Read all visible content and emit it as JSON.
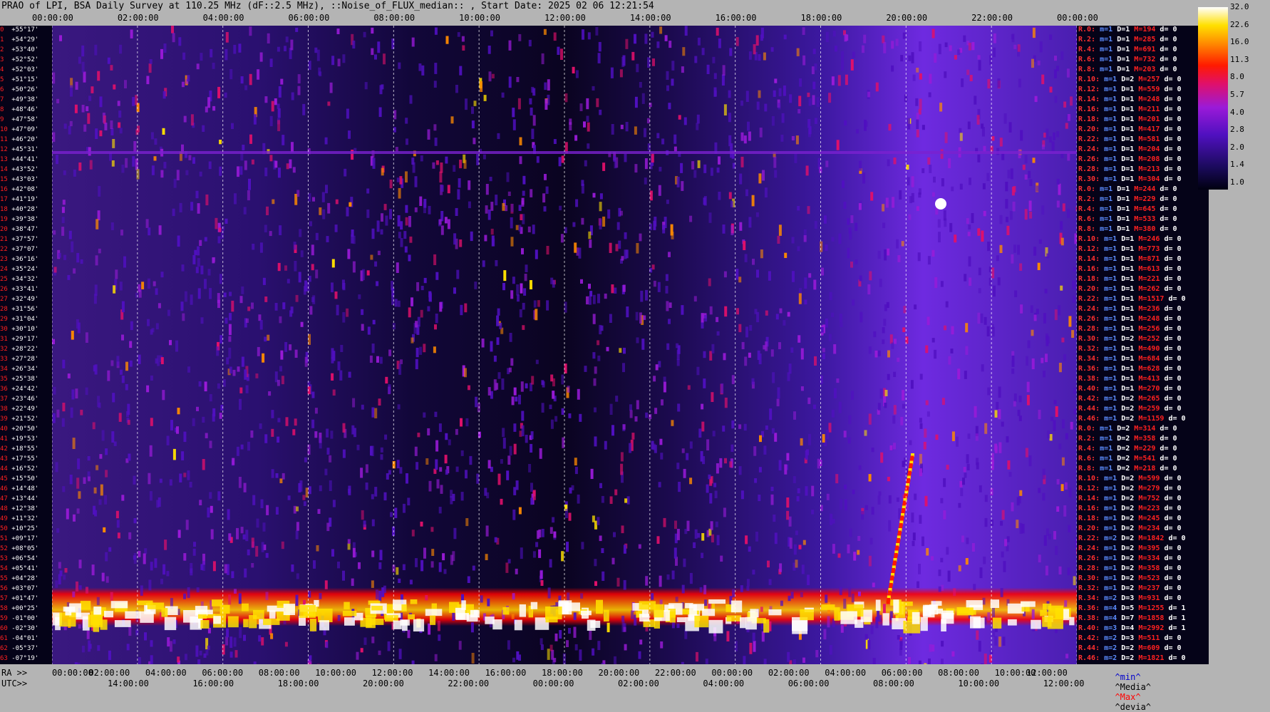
{
  "title": "PRAO of LPI, BSA Daily Survey at 110.25 MHz (dF::2.5 MHz), ::Noise_of_FLUX_median:: , Start Date: 2025 02 06 12:21:54",
  "chart_data": {
    "type": "heatmap",
    "title": "PRAO of LPI, BSA Daily Survey at 110.25 MHz (dF::2.5 MHz), ::Noise_of_FLUX_median:: , Start Date: 2025 02 06 12:21:54",
    "top_axis_ticks": [
      "00:00:00",
      "02:00:00",
      "04:00:00",
      "06:00:00",
      "08:00:00",
      "10:00:00",
      "12:00:00",
      "14:00:00",
      "16:00:00",
      "18:00:00",
      "20:00:00",
      "22:00:00",
      "00:00:00"
    ],
    "ra_axis_label": "RA >>",
    "ra_axis_ticks": [
      "00:00:00",
      "02:00:00",
      "04:00:00",
      "06:00:00",
      "08:00:00",
      "10:00:00",
      "12:00:00",
      "14:00:00",
      "16:00:00",
      "18:00:00",
      "20:00:00",
      "22:00:00",
      "00:00:00",
      "02:00:00",
      "04:00:00",
      "06:00:00",
      "08:00:00",
      "10:00:00",
      "12:00:00"
    ],
    "utc_axis_label": "UTC>>",
    "utc_axis_ticks": [
      "14:00:00",
      "16:00:00",
      "18:00:00",
      "20:00:00",
      "22:00:00",
      "00:00:00",
      "02:00:00",
      "04:00:00",
      "06:00:00",
      "08:00:00",
      "10:00:00",
      "12:00:00"
    ],
    "colorbar_ticks": [
      "32.0",
      "22.6",
      "16.0",
      "11.3",
      "8.0",
      "5.7",
      "4.0",
      "2.8",
      "2.0",
      "1.4",
      "1.0"
    ],
    "colorbar_range": [
      1.0,
      32.0
    ],
    "colorbar_colors": [
      "#000010",
      "#1a0a5a",
      "#5010c0",
      "#9a1ad8",
      "#e0106a",
      "#ff1a00",
      "#ff8a00",
      "#ffe000",
      "#ffffff"
    ],
    "declinations": [
      "+55°17'",
      "+54°29'",
      "+53°40'",
      "+52°52'",
      "+52°03'",
      "+51°15'",
      "+50°26'",
      "+49°38'",
      "+48°46'",
      "+47°58'",
      "+47°09'",
      "+46°20'",
      "+45°31'",
      "+44°41'",
      "+43°52'",
      "+43°03'",
      "+42°08'",
      "+41°19'",
      "+40°28'",
      "+39°38'",
      "+38°47'",
      "+37°57'",
      "+37°07'",
      "+36°16'",
      "+35°24'",
      "+34°32'",
      "+33°41'",
      "+32°49'",
      "+31°56'",
      "+31°04'",
      "+30°10'",
      "+29°17'",
      "+28°22'",
      "+27°28'",
      "+26°34'",
      "+25°38'",
      "+24°42'",
      "+23°46'",
      "+22°49'",
      "+21°52'",
      "+20°50'",
      "+19°53'",
      "+18°55'",
      "+17°55'",
      "+16°52'",
      "+15°50'",
      "+14°48'",
      "+13°44'",
      "+12°38'",
      "+11°32'",
      "+10°25'",
      "+09°17'",
      "+08°05'",
      "+06°54'",
      "+05°41'",
      "+04°28'",
      "+03°07'",
      "+01°47'",
      "+00°25'",
      "-01°00'",
      "-02°30'",
      "-04°01'",
      "-05°37'",
      "-07°19'"
    ],
    "beam_stats": [
      {
        "r": "R.0:",
        "m": "1",
        "D": "1",
        "M": "194",
        "d": "0"
      },
      {
        "r": "R.2:",
        "m": "1",
        "D": "1",
        "M": "285",
        "d": "0"
      },
      {
        "r": "R.4:",
        "m": "1",
        "D": "1",
        "M": "691",
        "d": "0"
      },
      {
        "r": "R.6:",
        "m": "1",
        "D": "1",
        "M": "732",
        "d": "0"
      },
      {
        "r": "R.8:",
        "m": "1",
        "D": "1",
        "M": "203",
        "d": "0"
      },
      {
        "r": "R.10:",
        "m": "1",
        "D": "2",
        "M": "257",
        "d": "0"
      },
      {
        "r": "R.12:",
        "m": "1",
        "D": "1",
        "M": "559",
        "d": "0"
      },
      {
        "r": "R.14:",
        "m": "1",
        "D": "1",
        "M": "248",
        "d": "0"
      },
      {
        "r": "R.16:",
        "m": "1",
        "D": "1",
        "M": "211",
        "d": "0"
      },
      {
        "r": "R.18:",
        "m": "1",
        "D": "1",
        "M": "201",
        "d": "0"
      },
      {
        "r": "R.20:",
        "m": "1",
        "D": "1",
        "M": "417",
        "d": "0"
      },
      {
        "r": "R.22:",
        "m": "1",
        "D": "1",
        "M": "581",
        "d": "0"
      },
      {
        "r": "R.24:",
        "m": "1",
        "D": "1",
        "M": "204",
        "d": "0"
      },
      {
        "r": "R.26:",
        "m": "1",
        "D": "1",
        "M": "208",
        "d": "0"
      },
      {
        "r": "R.28:",
        "m": "1",
        "D": "1",
        "M": "213",
        "d": "0"
      },
      {
        "r": "R.30:",
        "m": "1",
        "D": "1",
        "M": "304",
        "d": "0"
      },
      {
        "r": "R.0:",
        "m": "1",
        "D": "1",
        "M": "244",
        "d": "0"
      },
      {
        "r": "R.2:",
        "m": "1",
        "D": "1",
        "M": "229",
        "d": "0"
      },
      {
        "r": "R.4:",
        "m": "1",
        "D": "1",
        "M": "645",
        "d": "0"
      },
      {
        "r": "R.6:",
        "m": "1",
        "D": "1",
        "M": "533",
        "d": "0"
      },
      {
        "r": "R.8:",
        "m": "1",
        "D": "1",
        "M": "380",
        "d": "0"
      },
      {
        "r": "R.10:",
        "m": "1",
        "D": "1",
        "M": "246",
        "d": "0"
      },
      {
        "r": "R.12:",
        "m": "1",
        "D": "1",
        "M": "773",
        "d": "0"
      },
      {
        "r": "R.14:",
        "m": "1",
        "D": "1",
        "M": "871",
        "d": "0"
      },
      {
        "r": "R.16:",
        "m": "1",
        "D": "1",
        "M": "613",
        "d": "0"
      },
      {
        "r": "R.18:",
        "m": "1",
        "D": "1",
        "M": "221",
        "d": "0"
      },
      {
        "r": "R.20:",
        "m": "1",
        "D": "1",
        "M": "262",
        "d": "0"
      },
      {
        "r": "R.22:",
        "m": "1",
        "D": "1",
        "M": "1517",
        "d": "0"
      },
      {
        "r": "R.24:",
        "m": "1",
        "D": "1",
        "M": "236",
        "d": "0"
      },
      {
        "r": "R.26:",
        "m": "1",
        "D": "1",
        "M": "248",
        "d": "0"
      },
      {
        "r": "R.28:",
        "m": "1",
        "D": "1",
        "M": "256",
        "d": "0"
      },
      {
        "r": "R.30:",
        "m": "1",
        "D": "2",
        "M": "252",
        "d": "0"
      },
      {
        "r": "R.32:",
        "m": "1",
        "D": "1",
        "M": "490",
        "d": "0"
      },
      {
        "r": "R.34:",
        "m": "1",
        "D": "1",
        "M": "684",
        "d": "0"
      },
      {
        "r": "R.36:",
        "m": "1",
        "D": "1",
        "M": "628",
        "d": "0"
      },
      {
        "r": "R.38:",
        "m": "1",
        "D": "1",
        "M": "413",
        "d": "0"
      },
      {
        "r": "R.40:",
        "m": "1",
        "D": "1",
        "M": "270",
        "d": "0"
      },
      {
        "r": "R.42:",
        "m": "1",
        "D": "2",
        "M": "265",
        "d": "0"
      },
      {
        "r": "R.44:",
        "m": "1",
        "D": "2",
        "M": "259",
        "d": "0"
      },
      {
        "r": "R.46:",
        "m": "1",
        "D": "2",
        "M": "1159",
        "d": "0"
      },
      {
        "r": "R.0:",
        "m": "1",
        "D": "2",
        "M": "314",
        "d": "0"
      },
      {
        "r": "R.2:",
        "m": "1",
        "D": "2",
        "M": "358",
        "d": "0"
      },
      {
        "r": "R.4:",
        "m": "1",
        "D": "2",
        "M": "229",
        "d": "0"
      },
      {
        "r": "R.6:",
        "m": "1",
        "D": "2",
        "M": "541",
        "d": "0"
      },
      {
        "r": "R.8:",
        "m": "1",
        "D": "2",
        "M": "218",
        "d": "0"
      },
      {
        "r": "R.10:",
        "m": "1",
        "D": "2",
        "M": "599",
        "d": "0"
      },
      {
        "r": "R.12:",
        "m": "1",
        "D": "2",
        "M": "279",
        "d": "0"
      },
      {
        "r": "R.14:",
        "m": "1",
        "D": "2",
        "M": "752",
        "d": "0"
      },
      {
        "r": "R.16:",
        "m": "1",
        "D": "2",
        "M": "223",
        "d": "0"
      },
      {
        "r": "R.18:",
        "m": "1",
        "D": "2",
        "M": "245",
        "d": "0"
      },
      {
        "r": "R.20:",
        "m": "1",
        "D": "2",
        "M": "234",
        "d": "0"
      },
      {
        "r": "R.22:",
        "m": "2",
        "D": "2",
        "M": "1842",
        "d": "0"
      },
      {
        "r": "R.24:",
        "m": "1",
        "D": "2",
        "M": "395",
        "d": "0"
      },
      {
        "r": "R.26:",
        "m": "1",
        "D": "2",
        "M": "334",
        "d": "0"
      },
      {
        "r": "R.28:",
        "m": "1",
        "D": "2",
        "M": "358",
        "d": "0"
      },
      {
        "r": "R.30:",
        "m": "1",
        "D": "2",
        "M": "523",
        "d": "0"
      },
      {
        "r": "R.32:",
        "m": "1",
        "D": "2",
        "M": "237",
        "d": "0"
      },
      {
        "r": "R.34:",
        "m": "2",
        "D": "3",
        "M": "931",
        "d": "0"
      },
      {
        "r": "R.36:",
        "m": "4",
        "D": "5",
        "M": "1255",
        "d": "1"
      },
      {
        "r": "R.38:",
        "m": "4",
        "D": "7",
        "M": "1858",
        "d": "1"
      },
      {
        "r": "R.40:",
        "m": "3",
        "D": "4",
        "M": "2992",
        "d": "1"
      },
      {
        "r": "R.42:",
        "m": "2",
        "D": "3",
        "M": "511",
        "d": "0"
      },
      {
        "r": "R.44:",
        "m": "2",
        "D": "2",
        "M": "609",
        "d": "0"
      },
      {
        "r": "R.46:",
        "m": "2",
        "D": "2",
        "M": "1821",
        "d": "0"
      }
    ],
    "legend": {
      "min": "^min^",
      "median": "^Media^",
      "max": "^Max^",
      "dev": "^devia^"
    }
  }
}
